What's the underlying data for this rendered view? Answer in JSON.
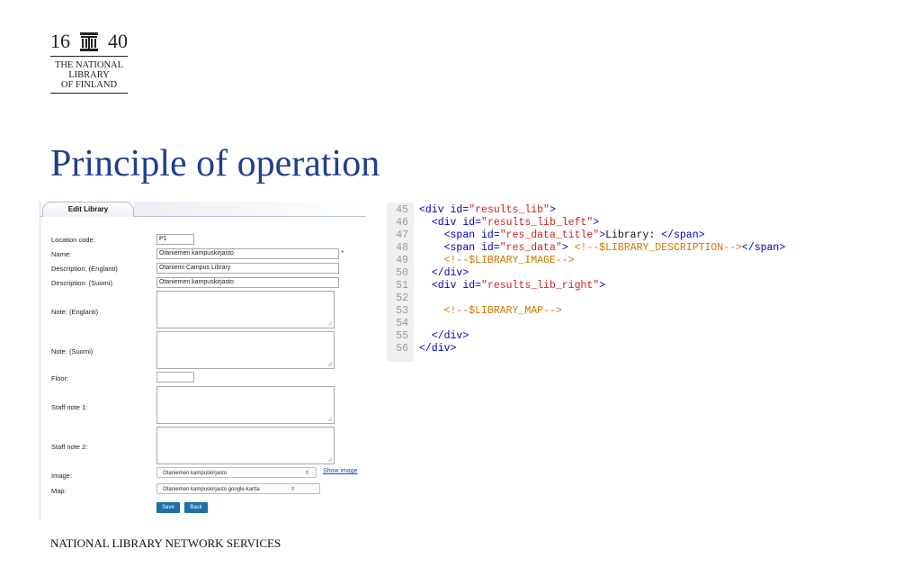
{
  "logo": {
    "year_left": "16",
    "year_right": "40",
    "lines": [
      "THE NATIONAL",
      "LIBRARY",
      "OF FINLAND"
    ]
  },
  "slide": {
    "title": "Principle of operation",
    "footer": "NATIONAL LIBRARY NETWORK SERVICES"
  },
  "form": {
    "tab_label": "Edit Library",
    "location_code": {
      "label": "Location code:",
      "value": "P1"
    },
    "name": {
      "label": "Name:",
      "value": "Otaniemen kampuskirjasto",
      "required_mark": "*"
    },
    "description_en": {
      "label": "Description: (Englanti)",
      "value": "Otaniemi Campus Library"
    },
    "description_fi": {
      "label": "Description: (Suomi)",
      "value": "Otaniemen kampuskirjasto"
    },
    "note_en": {
      "label": "Note: (Englanti)",
      "value": ""
    },
    "note_fi": {
      "label": "Note: (Suomi)",
      "value": ""
    },
    "floor": {
      "label": "Floor:",
      "value": ""
    },
    "staff_note_1": {
      "label": "Staff note 1:",
      "value": ""
    },
    "staff_note_2": {
      "label": "Staff note 2:",
      "value": ""
    },
    "image": {
      "label": "Image:",
      "selected": "Otaniemen kampuskirjasto",
      "link": "Show image"
    },
    "map": {
      "label": "Map:",
      "selected": "Otaniemen kampuskirjasto google-kartta"
    },
    "save_label": "Save",
    "back_label": "Back"
  },
  "code": {
    "lines": [
      {
        "n": "45",
        "indent": "",
        "parts": [
          [
            "tag",
            "<div "
          ],
          [
            "attr",
            "id="
          ],
          [
            "val",
            "\"results_lib\""
          ],
          [
            "tag",
            ">"
          ]
        ]
      },
      {
        "n": "46",
        "indent": "  ",
        "parts": [
          [
            "tag",
            "<div "
          ],
          [
            "attr",
            "id="
          ],
          [
            "val",
            "\"results_lib_left\""
          ],
          [
            "tag",
            ">"
          ]
        ]
      },
      {
        "n": "47",
        "indent": "    ",
        "parts": [
          [
            "tag",
            "<span "
          ],
          [
            "attr",
            "id="
          ],
          [
            "val",
            "\"res_data_title\""
          ],
          [
            "tag",
            ">"
          ],
          [
            "txt",
            "Library: "
          ],
          [
            "tag",
            "</span>"
          ]
        ]
      },
      {
        "n": "48",
        "indent": "    ",
        "parts": [
          [
            "tag",
            "<span "
          ],
          [
            "attr",
            "id="
          ],
          [
            "val",
            "\"res_data\""
          ],
          [
            "tag",
            "> "
          ],
          [
            "cmt",
            "<!--$LIBRARY_DESCRIPTION-->"
          ],
          [
            "tag",
            "</span>"
          ]
        ]
      },
      {
        "n": "49",
        "indent": "    ",
        "parts": [
          [
            "cmt",
            "<!--$LIBRARY_IMAGE-->"
          ]
        ]
      },
      {
        "n": "50",
        "indent": "  ",
        "parts": [
          [
            "tag",
            "</div>"
          ]
        ]
      },
      {
        "n": "51",
        "indent": "  ",
        "parts": [
          [
            "tag",
            "<div "
          ],
          [
            "attr",
            "id="
          ],
          [
            "val",
            "\"results_lib_right\""
          ],
          [
            "tag",
            ">"
          ]
        ]
      },
      {
        "n": "52",
        "indent": "",
        "parts": []
      },
      {
        "n": "53",
        "indent": "    ",
        "parts": [
          [
            "cmt",
            "<!--$LIBRARY_MAP-->"
          ]
        ]
      },
      {
        "n": "54",
        "indent": "",
        "parts": []
      },
      {
        "n": "55",
        "indent": "  ",
        "parts": [
          [
            "tag",
            "</div>"
          ]
        ]
      },
      {
        "n": "56",
        "indent": "",
        "parts": [
          [
            "tag",
            "</div>"
          ]
        ]
      }
    ]
  }
}
